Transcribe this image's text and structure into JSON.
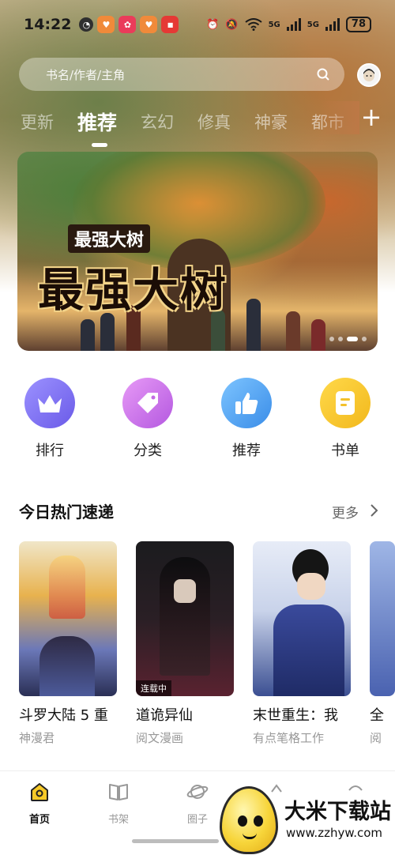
{
  "status_bar": {
    "time": "14:22",
    "network_5g_1": "5G",
    "network_5g_2": "5G",
    "battery": "78"
  },
  "search": {
    "placeholder": "书名/作者/主角"
  },
  "tabs": [
    {
      "label": "更新"
    },
    {
      "label": "推荐"
    },
    {
      "label": "玄幻"
    },
    {
      "label": "修真"
    },
    {
      "label": "神豪"
    },
    {
      "label": "都市"
    }
  ],
  "banner": {
    "small_title": "最强大树",
    "title": "最强大树"
  },
  "categories": [
    {
      "label": "排行",
      "icon": "crown-icon",
      "color": "#7a6cf0"
    },
    {
      "label": "分类",
      "icon": "tag-icon",
      "color": "#c96be6"
    },
    {
      "label": "推荐",
      "icon": "thumbs-up-icon",
      "color": "#4a9cf2"
    },
    {
      "label": "书单",
      "icon": "booklist-icon",
      "color": "#f3c12b"
    }
  ],
  "section": {
    "title": "今日热门速递",
    "more": "更多"
  },
  "comics": [
    {
      "title": "斗罗大陆 5 重",
      "author": "神漫君",
      "badge": ""
    },
    {
      "title": "道诡异仙",
      "author": "阅文漫画",
      "badge": "连载中"
    },
    {
      "title": "末世重生：我",
      "author": "有点笔格工作",
      "badge": ""
    },
    {
      "title": "全",
      "author": "阅",
      "badge": ""
    }
  ],
  "bottom_nav": [
    {
      "label": "首页",
      "icon": "home-icon"
    },
    {
      "label": "书架",
      "icon": "bookshelf-icon"
    },
    {
      "label": "圈子",
      "icon": "planet-icon"
    },
    {
      "label": "",
      "icon": "discover-icon"
    },
    {
      "label": "",
      "icon": "profile-icon"
    }
  ],
  "watermark": {
    "text": "大米下载站",
    "url": "www.zzhyw.com"
  }
}
